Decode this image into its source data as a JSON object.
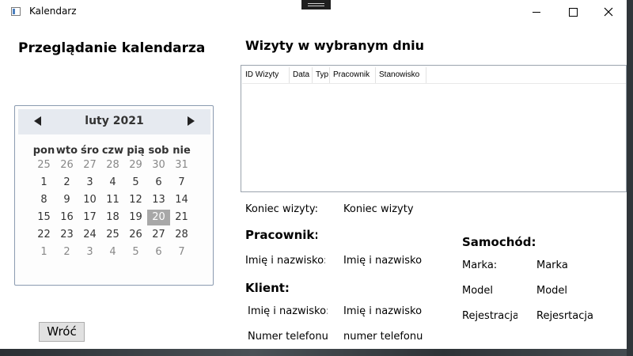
{
  "window": {
    "title": "Kalendarz"
  },
  "left": {
    "heading": "Przeglądanie kalendarza",
    "calendar": {
      "month_label": "luty 2021",
      "weekdays": [
        "pon",
        "wto",
        "śro",
        "czw",
        "pią",
        "sob",
        "nie"
      ],
      "weeks": [
        [
          "25",
          "26",
          "27",
          "28",
          "29",
          "30",
          "31"
        ],
        [
          "1",
          "2",
          "3",
          "4",
          "5",
          "6",
          "7"
        ],
        [
          "8",
          "9",
          "10",
          "11",
          "12",
          "13",
          "14"
        ],
        [
          "15",
          "16",
          "17",
          "18",
          "19",
          "20",
          "21"
        ],
        [
          "22",
          "23",
          "24",
          "25",
          "26",
          "27",
          "28"
        ],
        [
          "1",
          "2",
          "3",
          "4",
          "5",
          "6",
          "7"
        ]
      ],
      "selected_day": "20"
    },
    "back_button": "Wróć"
  },
  "right": {
    "heading": "Wizyty w wybranym dniu",
    "grid_columns": [
      "ID Wizyty",
      "Data",
      "Typ",
      "Pracownik",
      "Stanowisko"
    ],
    "end_label": "Koniec wizyty:",
    "end_value": "Koniec wizyty",
    "employee_heading": "Pracownik:",
    "employee_name_label": "Imię i nazwisko:",
    "employee_name_value": "Imię i nazwisko",
    "client_heading": "Klient:",
    "client_name_label": "Imię i nazwisko:",
    "client_name_value": "Imię i nazwisko",
    "client_phone_label": "Numer telefonu:",
    "client_phone_value": "numer telefonu",
    "car_heading": "Samochód:",
    "car_make_label": "Marka:",
    "car_make_value": "Marka",
    "car_model_label": "Model",
    "car_model_value": "Model",
    "car_reg_label": "Rejestracja:",
    "car_reg_value": "Rejesrtacja"
  }
}
